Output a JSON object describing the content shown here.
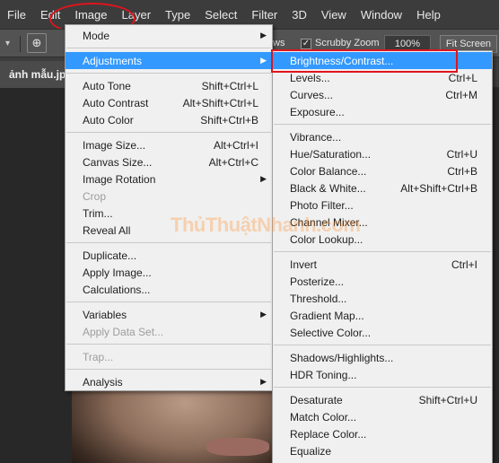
{
  "menubar": {
    "items": [
      "File",
      "Edit",
      "Image",
      "Layer",
      "Type",
      "Select",
      "Filter",
      "3D",
      "View",
      "Window",
      "Help"
    ],
    "active": "Image"
  },
  "options_bar": {
    "scrubby_zoom_label": "Scrubby Zoom",
    "scrubby_zoom_checked": true,
    "zoom_value": "100%",
    "fit_screen_label": "Fit Screen",
    "partial_label": "ws"
  },
  "document_tab": {
    "title": "ảnh mẫu.jp"
  },
  "image_menu": {
    "items": [
      {
        "label": "Mode",
        "shortcut": "",
        "submenu": true,
        "disabled": false
      },
      {
        "sep": true
      },
      {
        "label": "Adjustments",
        "shortcut": "",
        "submenu": true,
        "disabled": false,
        "highlighted": true
      },
      {
        "sep": true
      },
      {
        "label": "Auto Tone",
        "shortcut": "Shift+Ctrl+L",
        "submenu": false,
        "disabled": false
      },
      {
        "label": "Auto Contrast",
        "shortcut": "Alt+Shift+Ctrl+L",
        "submenu": false,
        "disabled": false
      },
      {
        "label": "Auto Color",
        "shortcut": "Shift+Ctrl+B",
        "submenu": false,
        "disabled": false
      },
      {
        "sep": true
      },
      {
        "label": "Image Size...",
        "shortcut": "Alt+Ctrl+I",
        "submenu": false,
        "disabled": false
      },
      {
        "label": "Canvas Size...",
        "shortcut": "Alt+Ctrl+C",
        "submenu": false,
        "disabled": false
      },
      {
        "label": "Image Rotation",
        "shortcut": "",
        "submenu": true,
        "disabled": false
      },
      {
        "label": "Crop",
        "shortcut": "",
        "submenu": false,
        "disabled": true
      },
      {
        "label": "Trim...",
        "shortcut": "",
        "submenu": false,
        "disabled": false
      },
      {
        "label": "Reveal All",
        "shortcut": "",
        "submenu": false,
        "disabled": false
      },
      {
        "sep": true
      },
      {
        "label": "Duplicate...",
        "shortcut": "",
        "submenu": false,
        "disabled": false
      },
      {
        "label": "Apply Image...",
        "shortcut": "",
        "submenu": false,
        "disabled": false
      },
      {
        "label": "Calculations...",
        "shortcut": "",
        "submenu": false,
        "disabled": false
      },
      {
        "sep": true
      },
      {
        "label": "Variables",
        "shortcut": "",
        "submenu": true,
        "disabled": false
      },
      {
        "label": "Apply Data Set...",
        "shortcut": "",
        "submenu": false,
        "disabled": true
      },
      {
        "sep": true
      },
      {
        "label": "Trap...",
        "shortcut": "",
        "submenu": false,
        "disabled": true
      },
      {
        "sep": true
      },
      {
        "label": "Analysis",
        "shortcut": "",
        "submenu": true,
        "disabled": false
      }
    ]
  },
  "adjustments_menu": {
    "items": [
      {
        "label": "Brightness/Contrast...",
        "shortcut": "",
        "highlighted": true
      },
      {
        "label": "Levels...",
        "shortcut": "Ctrl+L"
      },
      {
        "label": "Curves...",
        "shortcut": "Ctrl+M"
      },
      {
        "label": "Exposure...",
        "shortcut": ""
      },
      {
        "sep": true
      },
      {
        "label": "Vibrance...",
        "shortcut": ""
      },
      {
        "label": "Hue/Saturation...",
        "shortcut": "Ctrl+U"
      },
      {
        "label": "Color Balance...",
        "shortcut": "Ctrl+B"
      },
      {
        "label": "Black & White...",
        "shortcut": "Alt+Shift+Ctrl+B"
      },
      {
        "label": "Photo Filter...",
        "shortcut": ""
      },
      {
        "label": "Channel Mixer...",
        "shortcut": ""
      },
      {
        "label": "Color Lookup...",
        "shortcut": ""
      },
      {
        "sep": true
      },
      {
        "label": "Invert",
        "shortcut": "Ctrl+I"
      },
      {
        "label": "Posterize...",
        "shortcut": ""
      },
      {
        "label": "Threshold...",
        "shortcut": ""
      },
      {
        "label": "Gradient Map...",
        "shortcut": ""
      },
      {
        "label": "Selective Color...",
        "shortcut": ""
      },
      {
        "sep": true
      },
      {
        "label": "Shadows/Highlights...",
        "shortcut": ""
      },
      {
        "label": "HDR Toning...",
        "shortcut": ""
      },
      {
        "sep": true
      },
      {
        "label": "Desaturate",
        "shortcut": "Shift+Ctrl+U"
      },
      {
        "label": "Match Color...",
        "shortcut": ""
      },
      {
        "label": "Replace Color...",
        "shortcut": ""
      },
      {
        "label": "Equalize",
        "shortcut": ""
      }
    ]
  },
  "watermark": {
    "text": "ThủThuậtNhanh.com"
  },
  "colors": {
    "highlight": "#3399ff",
    "annotation_red": "#e0141c"
  }
}
